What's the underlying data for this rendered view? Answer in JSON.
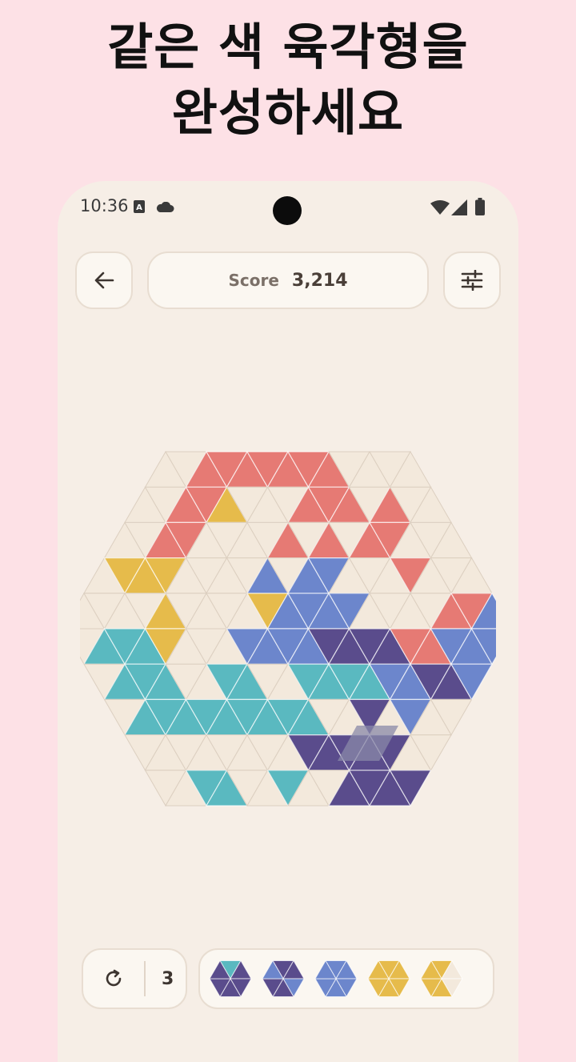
{
  "headline": {
    "line1": "같은 색 육각형을",
    "line2": "완성하세요"
  },
  "status_bar": {
    "time": "10:36"
  },
  "header": {
    "score_label": "Score",
    "score_value": "3,214"
  },
  "bottom": {
    "undo_count": "3"
  },
  "colors": {
    "empty": "#f3e9dc",
    "grid_line": "#dccfc0",
    "red": "#e67a74",
    "yellow": "#e6bb4b",
    "teal": "#5ab9c0",
    "blue": "#6c86cc",
    "purple": "#5a4c8c"
  },
  "board": {
    "rows": [
      "EERRRRRRREEEE",
      "EERRYEEERRREREE",
      "EERREEEERERERREEE",
      "EYYYEEEEBEBBEEEREEE",
      "EEEEYEEEEYBBBBEEEERRBBB",
      "ETTTYEEEBBBBPPPPRRBBB",
      "ETTTEETTEETTTTBBPPBBEEE",
      "ETTTTTTTTTEEPEBEEEE",
      "EEEEEEEEPPPPPEEEE",
      "EETTEETEEPPPPPPEE",
      "EETTEEPEPPPPPEEEE"
    ],
    "highlight": "selected-piece-ghost"
  },
  "piece_tray": [
    {
      "name": "piece-1",
      "colors": [
        "teal",
        "purple",
        "purple",
        "purple",
        "purple",
        "purple"
      ]
    },
    {
      "name": "piece-2",
      "colors": [
        "purple",
        "purple",
        "blue",
        "purple",
        "purple",
        "blue"
      ]
    },
    {
      "name": "piece-3",
      "colors": [
        "blue",
        "blue",
        "blue",
        "blue",
        "blue",
        "blue"
      ]
    },
    {
      "name": "piece-4",
      "colors": [
        "yellow",
        "yellow",
        "yellow",
        "yellow",
        "yellow",
        "yellow"
      ]
    },
    {
      "name": "piece-5",
      "colors": [
        "yellow",
        "empty",
        "empty",
        "yellow",
        "yellow",
        "yellow"
      ]
    }
  ]
}
